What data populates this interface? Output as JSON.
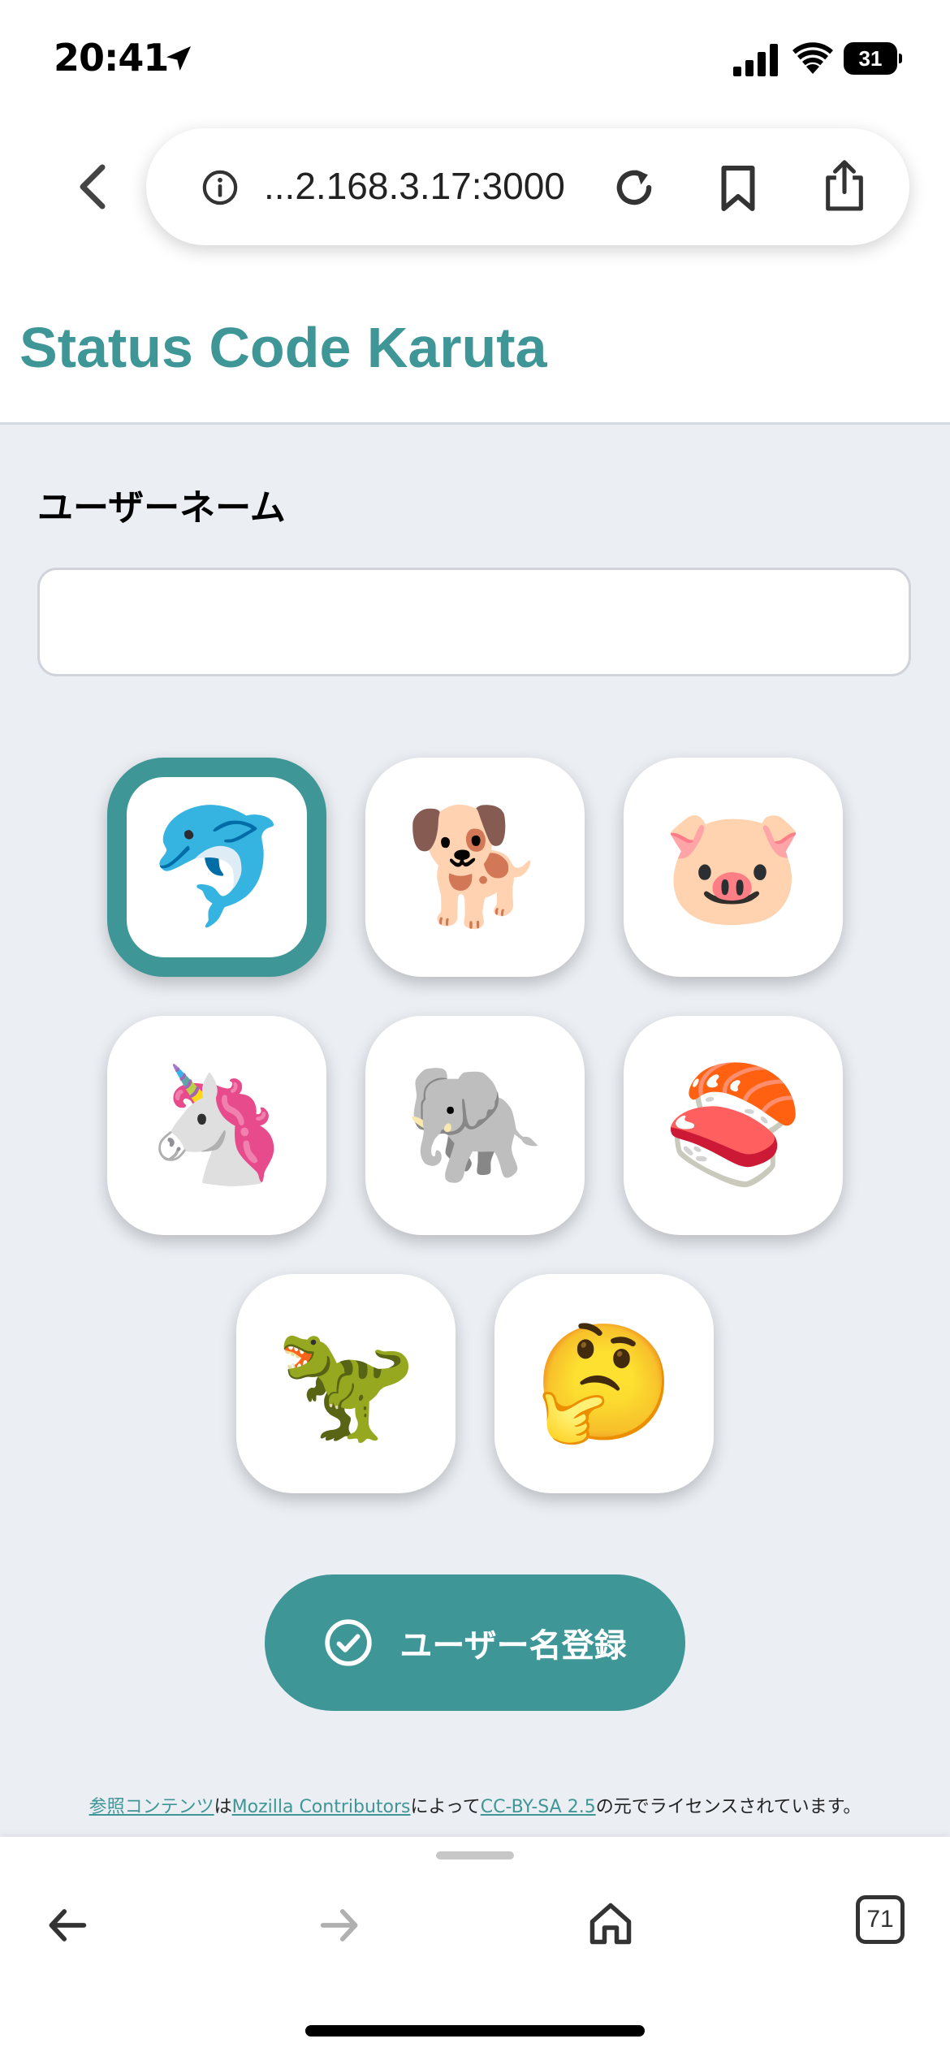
{
  "status_bar": {
    "time": "20:41",
    "battery": "31"
  },
  "browser": {
    "url": "...2.168.3.17:3000",
    "tab_count": "71"
  },
  "header": {
    "title": "Status Code Karuta"
  },
  "form": {
    "username_label": "ユーザーネーム",
    "username_value": "",
    "avatars": [
      {
        "name": "dolphin",
        "emoji": "🐬",
        "selected": true
      },
      {
        "name": "dog",
        "emoji": "🐕",
        "selected": false
      },
      {
        "name": "pig",
        "emoji": "🐷",
        "selected": false
      },
      {
        "name": "unicorn",
        "emoji": "🦄",
        "selected": false
      },
      {
        "name": "elephant",
        "emoji": "🐘",
        "selected": false
      },
      {
        "name": "sushi",
        "emoji": "🍣",
        "selected": false
      },
      {
        "name": "t-rex",
        "emoji": "🦖",
        "selected": false
      },
      {
        "name": "thinking-face",
        "emoji": "🤔",
        "selected": false
      }
    ],
    "submit_label": "ユーザー名登録"
  },
  "footer": {
    "link1": "参照コンテンツ",
    "text1": "は",
    "link2": "Mozilla Contributors",
    "text2": "によって",
    "link3": "CC-BY-SA 2.5",
    "text3": "の元でライセンスされています。"
  },
  "colors": {
    "accent": "#3f9696",
    "background": "#ebeff4"
  }
}
